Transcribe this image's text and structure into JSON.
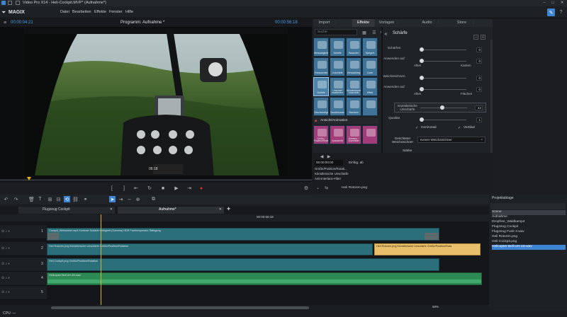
{
  "window": {
    "title": "Video Pro X14 - Heli-Cockpit.MVP* (Aufnahme*)"
  },
  "menu": {
    "brand": "MAGIX",
    "items": [
      "Datei",
      "Bearbeiten",
      "Effekte",
      "Fenster",
      "Hilfe"
    ]
  },
  "player": {
    "timecode_left": "00:00:04:21",
    "title": "Programm: Aufnahme *",
    "timecode_right": "00:00:56:18",
    "viewer_timecode": "06:18"
  },
  "right_tabs": [
    "Import",
    "Effekte",
    "Vorlagen",
    "Audio",
    "Store"
  ],
  "effects": {
    "search_placeholder": "Suche",
    "section": "Ansicht/Animation",
    "tiles": [
      {
        "label": "Weissabgleich",
        "color": "#3f7398"
      },
      {
        "label": "Schärfe",
        "color": "#3f7398"
      },
      {
        "label": "Rauschen",
        "color": "#3f7398"
      },
      {
        "label": "Spiegeln",
        "color": "#3f7398"
      },
      {
        "label": "Entrauschen",
        "color": "#3f7398"
      },
      {
        "label": "Unschärfe",
        "color": "#3f7398"
      },
      {
        "label": "Verwacklung",
        "color": "#3f7398"
      },
      {
        "label": "Zoom",
        "color": "#3f7398"
      },
      {
        "label": "Schärfe",
        "color": "#4c82a8"
      },
      {
        "label": "Unscharf maskieren",
        "color": "#3f7398"
      },
      {
        "label": "Künstlerische Unschärfe",
        "color": "#3f7398"
      },
      {
        "label": "Effekt",
        "color": "#3f7398"
      },
      {
        "label": "Geschwindigkeit",
        "color": "#3f7398"
      },
      {
        "label": "Gesichtsunschärfe",
        "color": "#3f7398"
      },
      {
        "label": "Standard",
        "color": "#3f7398"
      },
      {
        "label": "",
        "color": "#3f7398"
      },
      {
        "label": "Größe / Position/Rotation",
        "color": "#a23d79"
      },
      {
        "label": "Ausschnitt",
        "color": "#a23d79"
      },
      {
        "label": "Kamera- / Zoomfahrt",
        "color": "#a23d79"
      },
      {
        "label": "",
        "color": "#a23d79"
      }
    ]
  },
  "sharpness": {
    "title": "Schärfe",
    "schaerfen": {
      "label": "Schärfen",
      "value": "0"
    },
    "anwenden1": {
      "label": "Anwenden auf",
      "left": "Alles",
      "right": "Kanten",
      "value": "0"
    },
    "weichzeichnen": {
      "label": "Weichzeichnen",
      "value": "0"
    },
    "anwenden2": {
      "label": "Anwenden auf",
      "left": "Alles",
      "right": "Flächen",
      "value": "0"
    },
    "kuenstlerisch": {
      "label": "Künstlerische Unschärfe",
      "value": "44"
    },
    "qualitaet": {
      "label": "Qualität",
      "value": "1"
    },
    "horizontal": "Horizontal",
    "vertikal": "Vertikal",
    "gerichtet": {
      "label": "Gerichteter Weichzeichner",
      "option": "Keiner Weichzeichner"
    },
    "staerke": "Stärke"
  },
  "keyframes": {
    "time": "00:00:00:00",
    "einfuegen": "Einfüg. ab",
    "rows": [
      "Größe/Position/Rotati...",
      "Künstlerische Unschärfe",
      "Anti-Interlace-Filter"
    ],
    "file": "Heli Rotoren.png"
  },
  "timeline": {
    "tab_left": "Flugzeug Cockpit",
    "tab_right": "Aufnahme*",
    "ruler_time": "00:00:56:18",
    "zoom": "68%",
    "tracks": [
      {
        "num": "1",
        "clip": "Cockpit_Weitwinkel.mp4 Kontrast Schärfe Helligkeit (Gamma) HDR Farbtemperatur Sättigung"
      },
      {
        "num": "2",
        "clip": "Heli Rotoren.png Künstlerische Unschärfe Größe/Position/Rotation",
        "extra": "Heli Rotoren.png Künstlerische Unschärfe Größe/Position/Rota"
      },
      {
        "num": "3",
        "clip": "Heli Cockpit.png Größe/Position/Rotation"
      },
      {
        "num": "4",
        "clip": "Helicopter Bell UH-1D.wav"
      },
      {
        "num": "5",
        "clip": ""
      }
    ]
  },
  "project": {
    "title": "Projektablage",
    "items": [
      "Szene",
      "Aufnahme",
      "Dropfree_Waldkamp4",
      "Flugzeug Cockpit",
      "Flugzeug Funk 3.wav",
      "Heli Rotoren.png",
      "Heli-Cockpit.png",
      "Helicopter Bell UH-1D.wav"
    ]
  },
  "status": {
    "text": "CPU: —"
  }
}
